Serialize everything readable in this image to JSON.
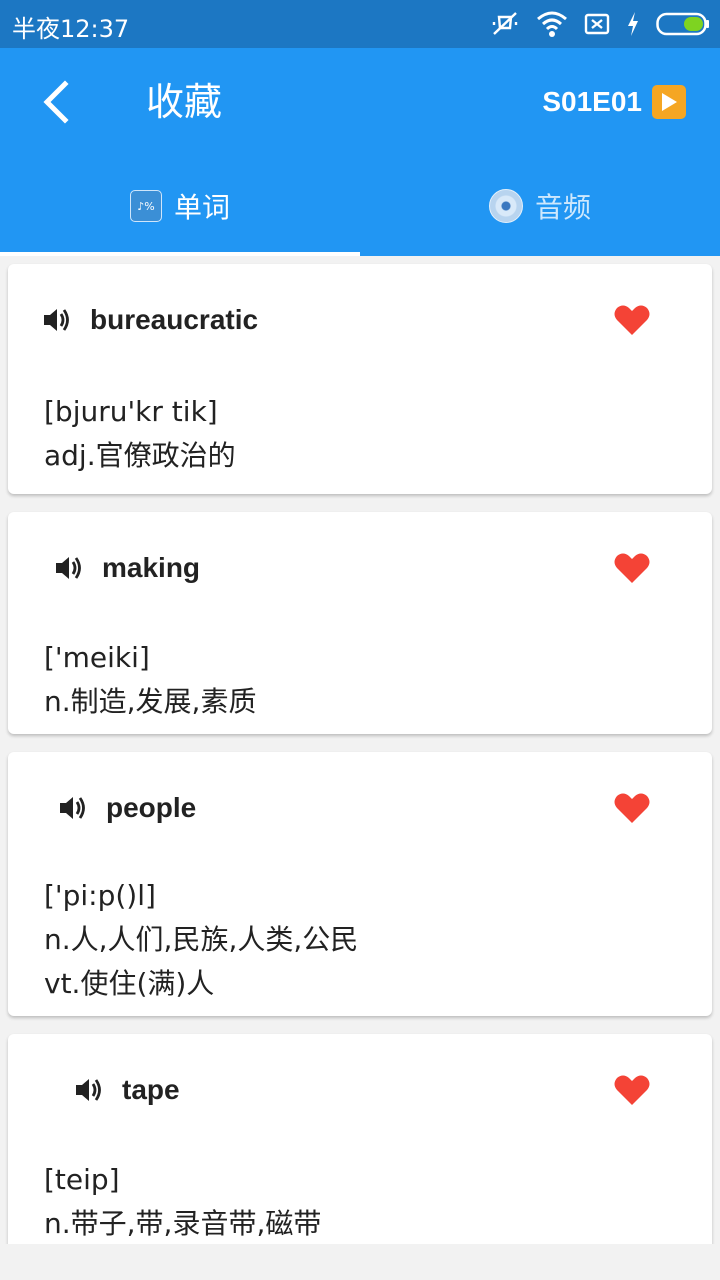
{
  "status_bar": {
    "time": "半夜12:37",
    "icons": [
      "mute-icon",
      "wifi-icon",
      "sim-x-icon",
      "charging-icon",
      "battery-icon"
    ]
  },
  "app_bar": {
    "back_icon": "chevron-left-icon",
    "title": "收藏",
    "episode_label": "S01E01",
    "play_icon": "play-button-icon"
  },
  "tabs": [
    {
      "label": "单词",
      "icon": "symbols-icon",
      "active": true
    },
    {
      "label": "音频",
      "icon": "disc-icon",
      "active": false
    }
  ],
  "words": [
    {
      "word": "bureaucratic",
      "phonetic": "[bjuru'kr tik]",
      "meanings": [
        "adj.官僚政治的"
      ],
      "favorited": true
    },
    {
      "word": "making",
      "phonetic": "['meiki]",
      "meanings": [
        "n.制造,发展,素质"
      ],
      "favorited": true
    },
    {
      "word": "people",
      "phonetic": "['pi:p()l]",
      "meanings": [
        "n.人,人们,民族,人类,公民",
        "vt.使住(满)人"
      ],
      "favorited": true
    },
    {
      "word": "tape",
      "phonetic": "[teip]",
      "meanings": [
        "n.带子,带,录音带,磁带"
      ],
      "favorited": true
    }
  ],
  "colors": {
    "status_bar": "#1c77c3",
    "primary": "#2196f3",
    "heart": "#f44336",
    "play": "#f5a623"
  }
}
